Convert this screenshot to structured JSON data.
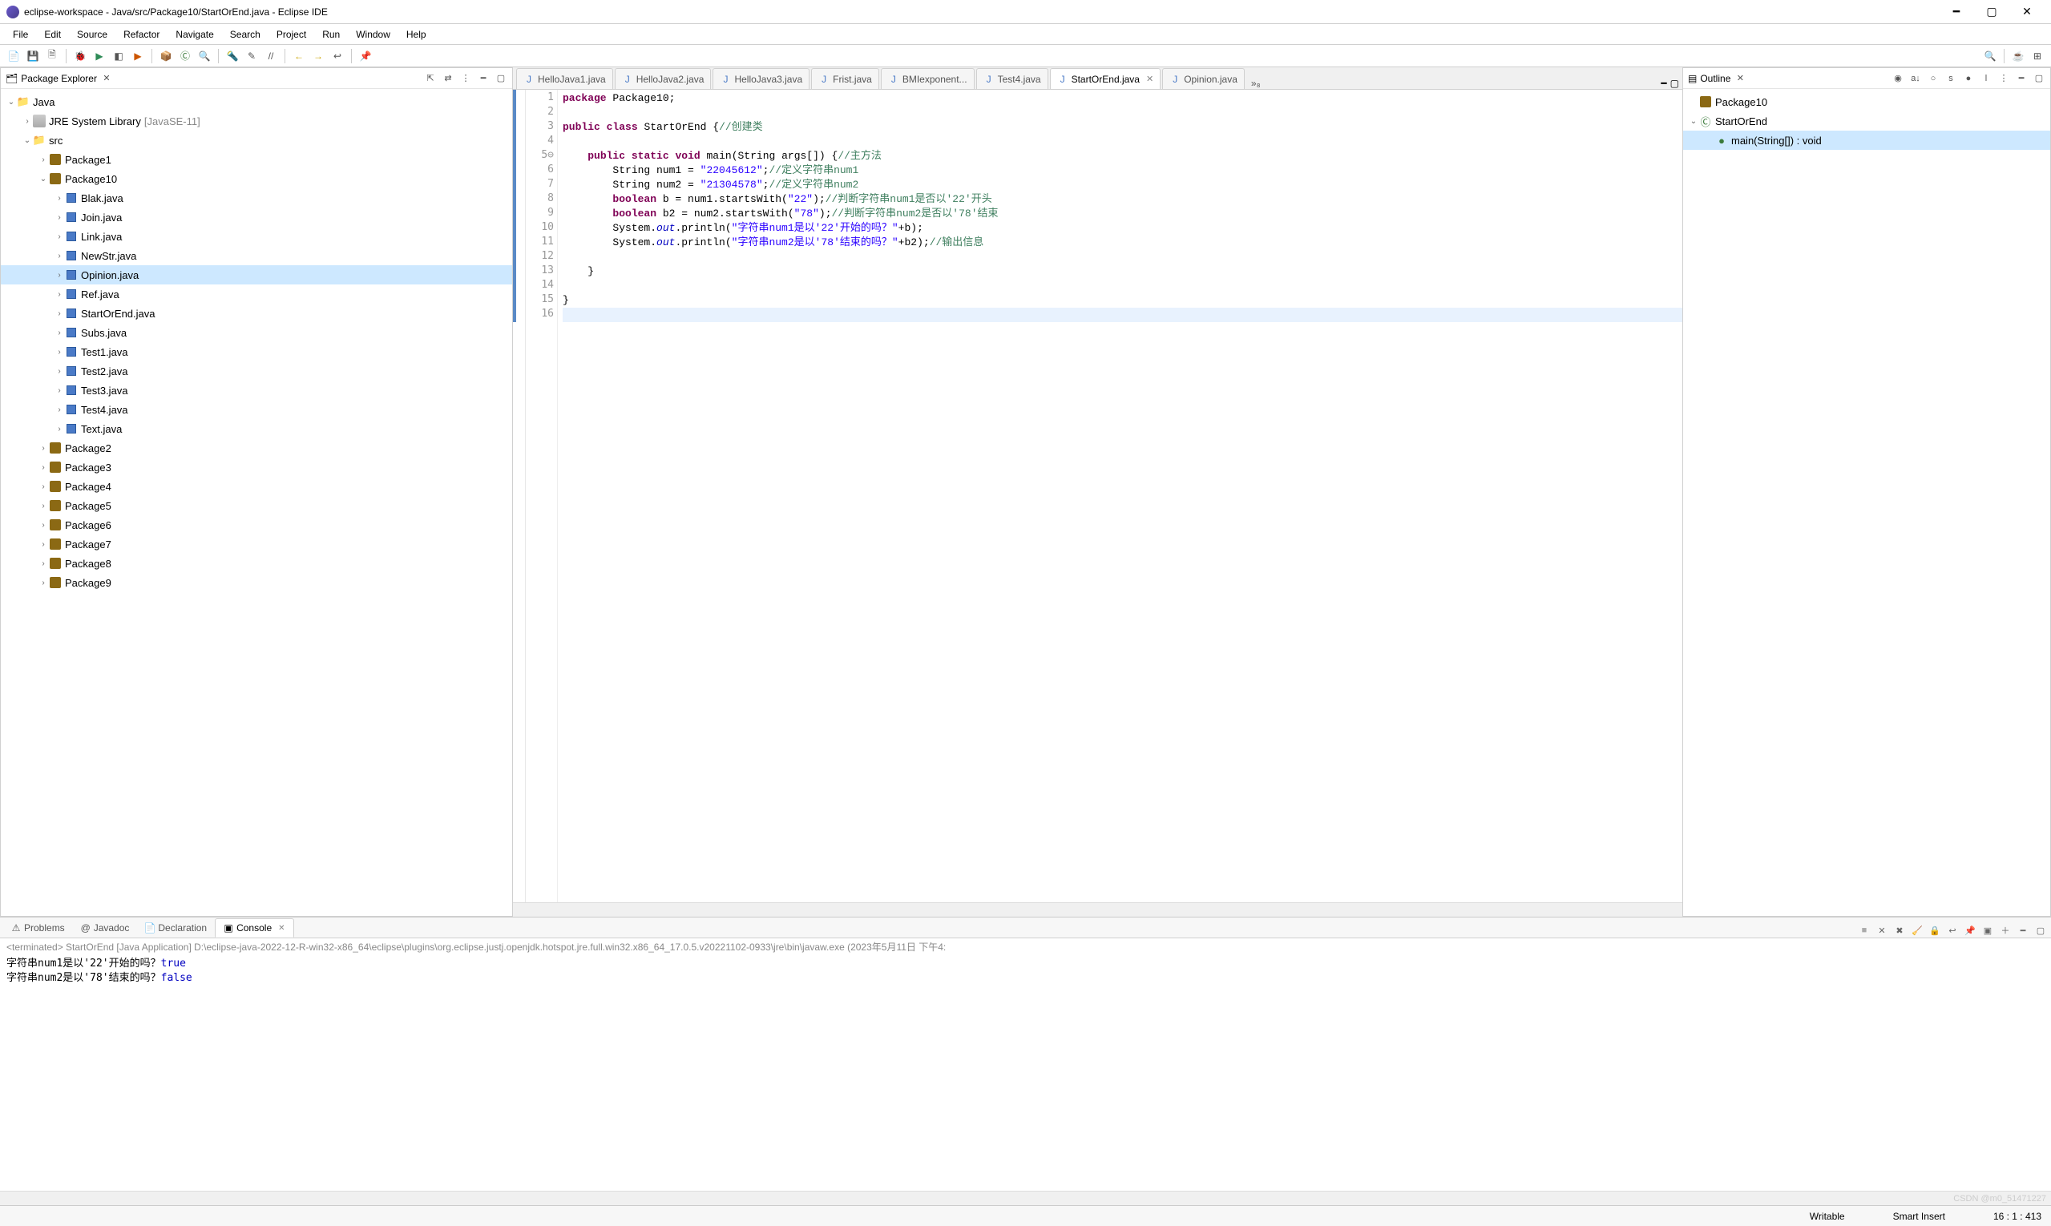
{
  "window": {
    "title": "eclipse-workspace - Java/src/Package10/StartOrEnd.java - Eclipse IDE"
  },
  "menu": [
    "File",
    "Edit",
    "Source",
    "Refactor",
    "Navigate",
    "Search",
    "Project",
    "Run",
    "Window",
    "Help"
  ],
  "pkg_explorer": {
    "title": "Package Explorer",
    "project": "Java",
    "library": "JRE System Library",
    "library_ann": "[JavaSE-11]",
    "src": "src",
    "packages_top": "Package1",
    "package10": "Package10",
    "files": [
      "Blak.java",
      "Join.java",
      "Link.java",
      "NewStr.java",
      "Opinion.java",
      "Ref.java",
      "StartOrEnd.java",
      "Subs.java",
      "Test1.java",
      "Test2.java",
      "Test3.java",
      "Test4.java",
      "Text.java"
    ],
    "selected_file": "Opinion.java",
    "other_pkgs": [
      "Package2",
      "Package3",
      "Package4",
      "Package5",
      "Package6",
      "Package7",
      "Package8",
      "Package9"
    ]
  },
  "tabs": [
    {
      "label": "HelloJava1.java",
      "active": false
    },
    {
      "label": "HelloJava2.java",
      "active": false
    },
    {
      "label": "HelloJava3.java",
      "active": false
    },
    {
      "label": "Frist.java",
      "active": false
    },
    {
      "label": "BMIexponent...",
      "active": false
    },
    {
      "label": "Test4.java",
      "active": false
    },
    {
      "label": "StartOrEnd.java",
      "active": true,
      "closable": true
    },
    {
      "label": "Opinion.java",
      "active": false
    }
  ],
  "code": {
    "lines": [
      {
        "n": 1,
        "segs": [
          {
            "t": "package",
            "c": "kw"
          },
          {
            "t": " Package10;",
            "c": ""
          }
        ]
      },
      {
        "n": 2,
        "segs": [
          {
            "t": "",
            "c": ""
          }
        ]
      },
      {
        "n": 3,
        "segs": [
          {
            "t": "public",
            "c": "kw"
          },
          {
            "t": " ",
            "c": ""
          },
          {
            "t": "class",
            "c": "kw"
          },
          {
            "t": " StartOrEnd {",
            "c": ""
          },
          {
            "t": "//创建类",
            "c": "cm"
          }
        ]
      },
      {
        "n": 4,
        "segs": [
          {
            "t": "",
            "c": ""
          }
        ]
      },
      {
        "n": "5⊖",
        "segs": [
          {
            "t": "    ",
            "c": ""
          },
          {
            "t": "public",
            "c": "kw"
          },
          {
            "t": " ",
            "c": ""
          },
          {
            "t": "static",
            "c": "kw"
          },
          {
            "t": " ",
            "c": ""
          },
          {
            "t": "void",
            "c": "kw"
          },
          {
            "t": " main(String args[]) {",
            "c": ""
          },
          {
            "t": "//主方法",
            "c": "cm"
          }
        ]
      },
      {
        "n": 6,
        "segs": [
          {
            "t": "        String num1 = ",
            "c": ""
          },
          {
            "t": "\"22045612\"",
            "c": "str"
          },
          {
            "t": ";",
            "c": ""
          },
          {
            "t": "//定义字符串num1",
            "c": "cm"
          }
        ]
      },
      {
        "n": 7,
        "segs": [
          {
            "t": "        String num2 = ",
            "c": ""
          },
          {
            "t": "\"21304578\"",
            "c": "str"
          },
          {
            "t": ";",
            "c": ""
          },
          {
            "t": "//定义字符串num2",
            "c": "cm"
          }
        ]
      },
      {
        "n": 8,
        "segs": [
          {
            "t": "        ",
            "c": ""
          },
          {
            "t": "boolean",
            "c": "kw"
          },
          {
            "t": " b = num1.startsWith(",
            "c": ""
          },
          {
            "t": "\"22\"",
            "c": "str"
          },
          {
            "t": ");",
            "c": ""
          },
          {
            "t": "//判断字符串num1是否以'22'开头",
            "c": "cm"
          }
        ]
      },
      {
        "n": 9,
        "segs": [
          {
            "t": "        ",
            "c": ""
          },
          {
            "t": "boolean",
            "c": "kw"
          },
          {
            "t": " b2 = num2.startsWith(",
            "c": ""
          },
          {
            "t": "\"78\"",
            "c": "str"
          },
          {
            "t": ");",
            "c": ""
          },
          {
            "t": "//判断字符串num2是否以'78'结束",
            "c": "cm"
          }
        ]
      },
      {
        "n": 10,
        "segs": [
          {
            "t": "        System.",
            "c": ""
          },
          {
            "t": "out",
            "c": "fld"
          },
          {
            "t": ".println(",
            "c": ""
          },
          {
            "t": "\"字符串num1是以'22'开始的吗？\"",
            "c": "str"
          },
          {
            "t": "+b);",
            "c": ""
          }
        ]
      },
      {
        "n": 11,
        "segs": [
          {
            "t": "        System.",
            "c": ""
          },
          {
            "t": "out",
            "c": "fld"
          },
          {
            "t": ".println(",
            "c": ""
          },
          {
            "t": "\"字符串num2是以'78'结束的吗？\"",
            "c": "str"
          },
          {
            "t": "+b2);",
            "c": ""
          },
          {
            "t": "//输出信息",
            "c": "cm"
          }
        ]
      },
      {
        "n": 12,
        "segs": [
          {
            "t": "",
            "c": ""
          }
        ]
      },
      {
        "n": 13,
        "segs": [
          {
            "t": "    }",
            "c": ""
          }
        ]
      },
      {
        "n": 14,
        "segs": [
          {
            "t": "",
            "c": ""
          }
        ]
      },
      {
        "n": 15,
        "segs": [
          {
            "t": "}",
            "c": ""
          }
        ]
      },
      {
        "n": 16,
        "segs": [
          {
            "t": "",
            "c": ""
          }
        ],
        "cursor": true
      }
    ]
  },
  "outline": {
    "title": "Outline",
    "root": "Package10",
    "class": "StartOrEnd",
    "method": "main(String[]) : void"
  },
  "bottom_tabs": [
    {
      "label": "Problems",
      "active": false,
      "icon": "⚠"
    },
    {
      "label": "Javadoc",
      "active": false,
      "icon": "@"
    },
    {
      "label": "Declaration",
      "active": false,
      "icon": "📄"
    },
    {
      "label": "Console",
      "active": true,
      "icon": "▣"
    }
  ],
  "console": {
    "header": "<terminated> StartOrEnd [Java Application] D:\\eclipse-java-2022-12-R-win32-x86_64\\eclipse\\plugins\\org.eclipse.justj.openjdk.hotspot.jre.full.win32.x86_64_17.0.5.v20221102-0933\\jre\\bin\\javaw.exe (2023年5月11日 下午4:",
    "line1_text": "字符串num1是以'22'开始的吗？",
    "line1_val": "true",
    "line2_text": "字符串num2是以'78'结束的吗？",
    "line2_val": "false"
  },
  "status": {
    "writable": "Writable",
    "insert": "Smart Insert",
    "pos": "16 : 1 : 413"
  },
  "watermark": "CSDN @m0_51471227"
}
